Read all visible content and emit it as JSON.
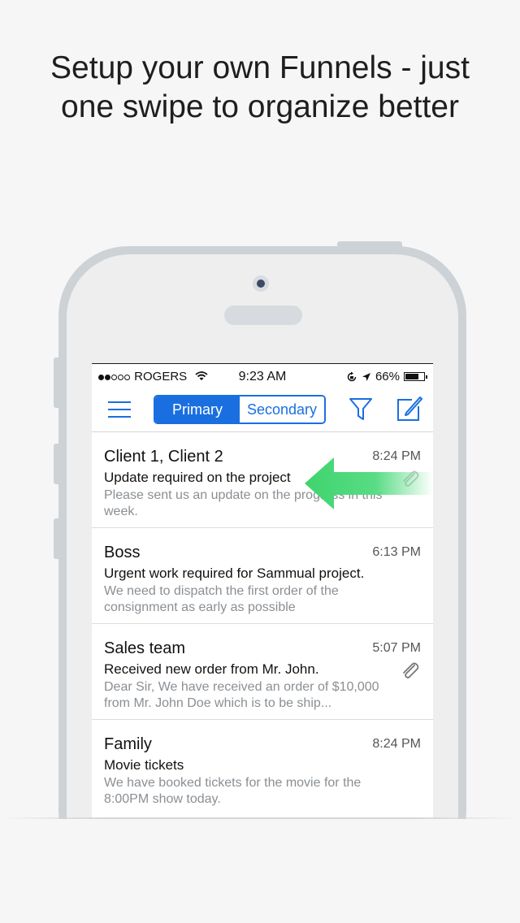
{
  "headline": {
    "line1": "Setup your own Funnels - just",
    "line2": "one swipe to organize better"
  },
  "status_bar": {
    "carrier": "ROGERS",
    "signal_bars_filled": 2,
    "signal_bars_total": 5,
    "time": "9:23 AM",
    "battery_percent": "66%",
    "battery_level": 0.66
  },
  "toolbar": {
    "segments": [
      "Primary",
      "Secondary"
    ],
    "selected_segment": "Primary"
  },
  "colors": {
    "accent": "#1a6fe0",
    "swipe_arrow": "#4cd97b"
  },
  "emails": [
    {
      "sender": "Client 1, Client 2",
      "time": "8:24 PM",
      "subject": "Update required on the project",
      "preview": "Please sent us an update on the progress in this week.",
      "has_attachment": true,
      "swiping": true
    },
    {
      "sender": "Boss",
      "time": "6:13 PM",
      "subject": "Urgent work required for Sammual project.",
      "preview": "We need to dispatch the first order of the consignment as early as possible",
      "has_attachment": false
    },
    {
      "sender": "Sales team",
      "time": "5:07 PM",
      "subject": "Received new order from Mr. John.",
      "preview": "Dear Sir, We have received an order of $10,000 from Mr. John Doe which is to be ship...",
      "has_attachment": true
    },
    {
      "sender": "Family",
      "time": "8:24 PM",
      "subject": "Movie tickets",
      "preview": "We have booked tickets for the movie for the 8:00PM show today.",
      "has_attachment": false
    }
  ]
}
